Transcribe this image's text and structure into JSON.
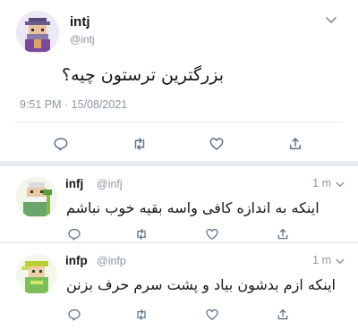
{
  "main_tweet": {
    "name": "intj",
    "handle": "@intj",
    "text": "بزرگترین ترستون چیه؟",
    "timestamp": "9:51 PM · 15/08/2021",
    "avatar_icon": "pixel-art-wizard-avatar"
  },
  "replies": [
    {
      "name": "infj",
      "handle": "@infj",
      "time": "1 m",
      "text": "اینکه به اندازه کافی واسه بقیه خوب نباشم",
      "avatar_icon": "pixel-art-sage-avatar"
    },
    {
      "name": "infp",
      "handle": "@infp",
      "time": "1 m",
      "text": "اینکه ازم بدشون بیاد و پشت سرم حرف بزنن",
      "avatar_icon": "pixel-art-elf-avatar"
    }
  ],
  "icons": {
    "reply": "reply-icon",
    "retweet": "retweet-icon",
    "like": "heart-icon",
    "share": "share-icon",
    "more": "chevron-down-icon"
  },
  "colors": {
    "icon_gray": "#5b7083",
    "secondary_text": "#8a96a3",
    "divider": "#e6ecf0"
  }
}
